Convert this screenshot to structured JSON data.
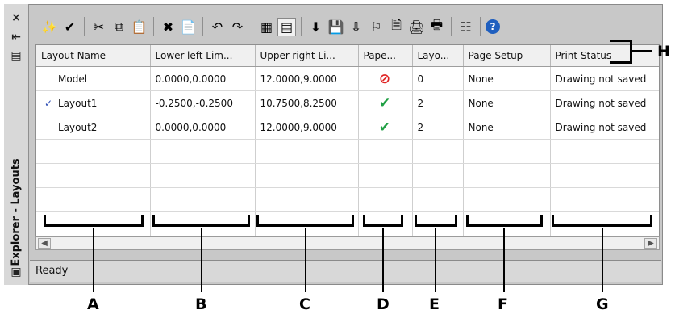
{
  "window": {
    "vertical_title": "Explorer - Layouts",
    "status_text": "Ready"
  },
  "sidebar": {
    "close_glyph": "×",
    "auto_hide_glyph": "⇤",
    "properties_glyph": "▤"
  },
  "toolbar": [
    {
      "name": "new-layout-icon",
      "glyph": "✨"
    },
    {
      "name": "set-current-icon",
      "glyph": "✔"
    },
    {
      "name": "cut-icon",
      "glyph": "✂"
    },
    {
      "name": "copy-icon",
      "glyph": "⧉"
    },
    {
      "name": "paste-icon",
      "glyph": "📋"
    },
    {
      "name": "delete-icon",
      "glyph": "✖"
    },
    {
      "name": "paste-special-icon",
      "glyph": "📄"
    },
    {
      "name": "undo-icon",
      "glyph": "↶"
    },
    {
      "name": "redo-icon",
      "glyph": "↷"
    },
    {
      "name": "large-icons-view-icon",
      "glyph": "▦"
    },
    {
      "name": "details-view-icon",
      "glyph": "▤"
    },
    {
      "name": "import-icon",
      "glyph": "⬇"
    },
    {
      "name": "save-icon",
      "glyph": "💾"
    },
    {
      "name": "export-icon",
      "glyph": "⇩"
    },
    {
      "name": "publish-icon",
      "glyph": "⚐"
    },
    {
      "name": "page-setup-icon",
      "glyph": "🗎"
    },
    {
      "name": "print-icon",
      "glyph": "🖨"
    },
    {
      "name": "plot-icon",
      "glyph": "🖶"
    },
    {
      "name": "properties-icon",
      "glyph": "☷"
    },
    {
      "name": "help-icon",
      "glyph": "?"
    }
  ],
  "columns": [
    "Layout Name",
    "Lower-left Lim...",
    "Upper-right Li...",
    "Pape...",
    "Layo...",
    "Page Setup",
    "Print Status"
  ],
  "rows": [
    {
      "name": "Model",
      "current": false,
      "lower_left": "0.0000,0.0000",
      "upper_right": "12.0000,9.0000",
      "paper": "no",
      "layout": "0",
      "page_setup": "None",
      "print_status": "Drawing not saved"
    },
    {
      "name": "Layout1",
      "current": true,
      "lower_left": "-0.2500,-0.2500",
      "upper_right": "10.7500,8.2500",
      "paper": "yes",
      "layout": "2",
      "page_setup": "None",
      "print_status": "Drawing not saved"
    },
    {
      "name": "Layout2",
      "current": false,
      "lower_left": "0.0000,0.0000",
      "upper_right": "12.0000,9.0000",
      "paper": "yes",
      "layout": "2",
      "page_setup": "None",
      "print_status": "Drawing not saved"
    }
  ],
  "annotations": {
    "column_labels": [
      "A",
      "B",
      "C",
      "D",
      "E",
      "F",
      "G"
    ],
    "header_label": "H"
  },
  "colors": {
    "current_check": "#2f4fb6",
    "paper_yes": "#21a045",
    "paper_no": "#e02222"
  }
}
